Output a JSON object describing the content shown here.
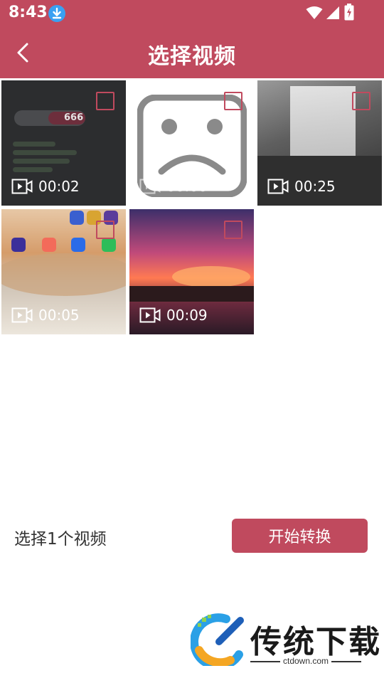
{
  "status": {
    "time": "8:43"
  },
  "header": {
    "title": "选择视频"
  },
  "videos": [
    {
      "duration": "00:02"
    },
    {
      "duration": "00:00"
    },
    {
      "duration": "00:25"
    },
    {
      "duration": "00:05"
    },
    {
      "duration": "00:09"
    }
  ],
  "thumbnail_text": {
    "counter": "666"
  },
  "footer": {
    "selection_label": "选择1个视频",
    "start_button_label": "开始转换"
  },
  "watermark": {
    "brand": "传统下载",
    "url": "ctdown.com"
  },
  "colors": {
    "accent": "#c04a5e",
    "background": "#ffffff"
  }
}
